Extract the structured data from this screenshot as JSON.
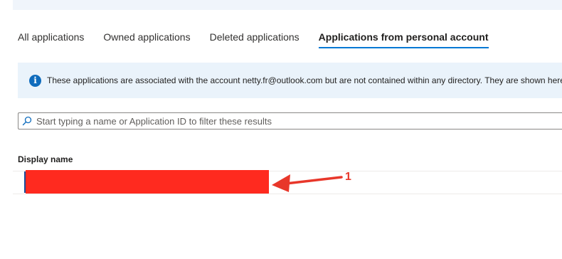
{
  "tabs": {
    "all": "All applications",
    "owned": "Owned applications",
    "deleted": "Deleted applications",
    "personal": "Applications from personal account"
  },
  "info_bar": {
    "icon": "info-icon",
    "text": "These applications are associated with the account netty.fr@outlook.com but are not contained within any directory.  They are shown here"
  },
  "search": {
    "icon": "search-icon",
    "placeholder": "Start typing a name or Application ID to filter these results",
    "value": ""
  },
  "table": {
    "columns": [
      "Display name"
    ]
  },
  "annotation": {
    "number": "1"
  },
  "colors": {
    "accent": "#0078d4",
    "info_background": "#eaf3fb",
    "redaction": "#ff2a1f",
    "annotation_arrow": "#e8372a"
  }
}
